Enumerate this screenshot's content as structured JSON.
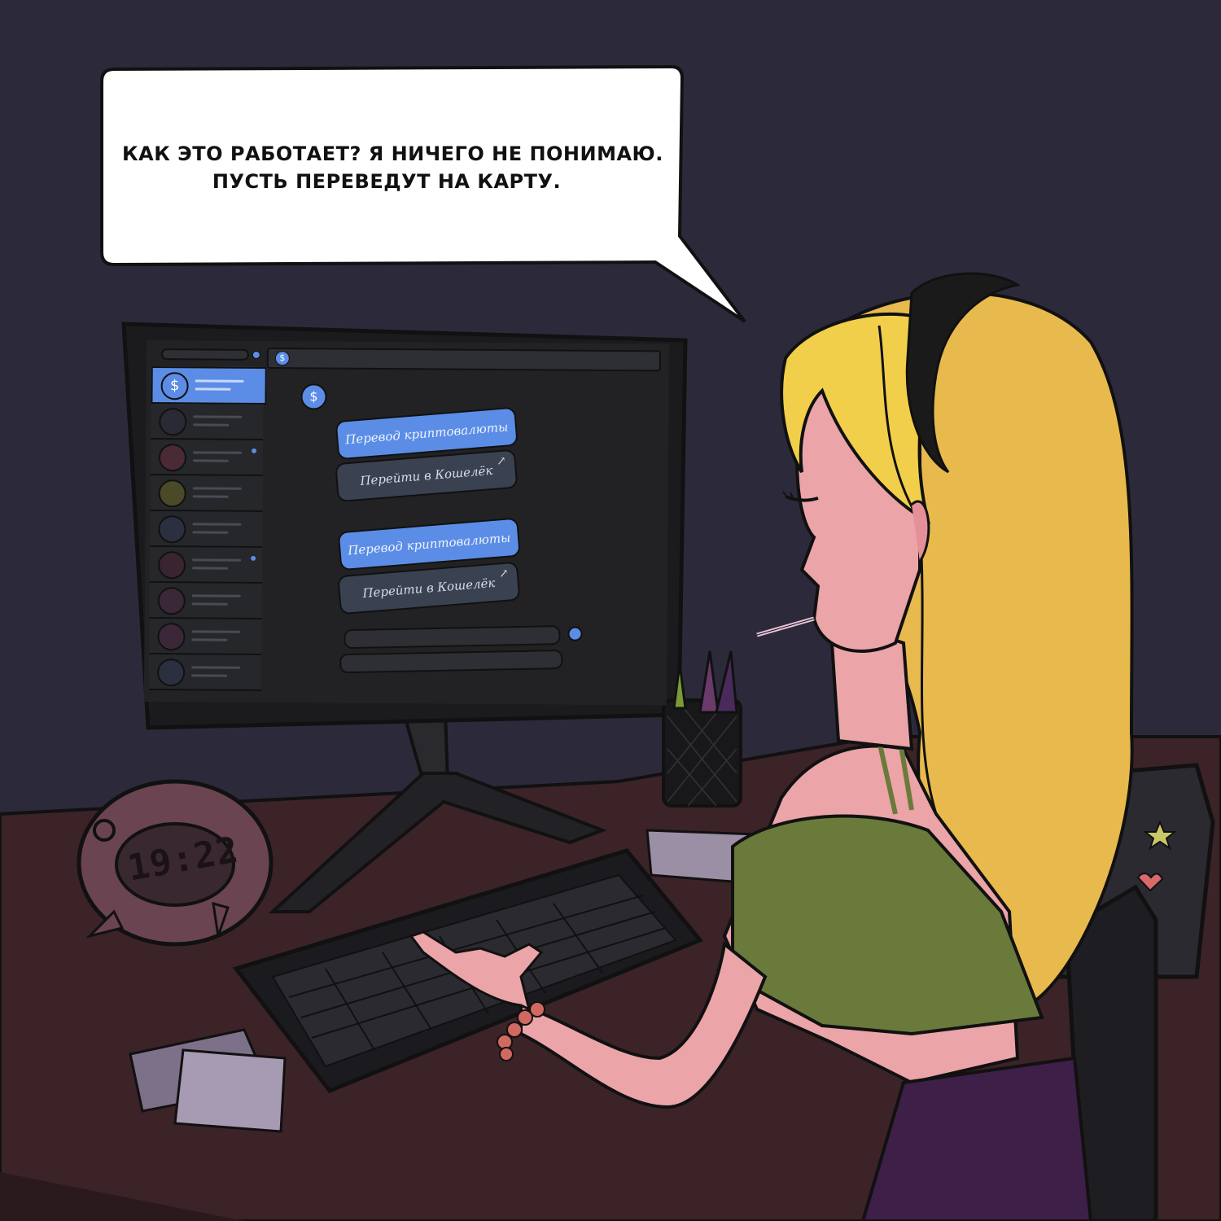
{
  "speech_bubble": {
    "line1": "КАК ЭТО РАБОТАЕТ? Я НИЧЕГО НЕ ПОНИМАЮ.",
    "line2": "ПУСТЬ ПЕРЕВЕДУТ НА КАРТУ."
  },
  "screen": {
    "bot_icon": "$",
    "messages": [
      {
        "text": "Перевод криптовалюты",
        "style": "blue"
      },
      {
        "text": "Перейти в Кошелёк",
        "style": "dark",
        "icon": "arrow-up-right-icon"
      },
      {
        "text": "Перевод криптовалюты",
        "style": "blue"
      },
      {
        "text": "Перейти в Кошелёк",
        "style": "dark",
        "icon": "arrow-up-right-icon"
      }
    ],
    "sidebar_active_icon": "$"
  },
  "clock": {
    "time": "19:22"
  },
  "colors": {
    "background": "#2c2a3a",
    "accent_blue": "#5b8de6",
    "desk": "#3a2428",
    "hair": "#f2cf4a",
    "top": "#6a7a3a",
    "skirt": "#3e1f48"
  }
}
